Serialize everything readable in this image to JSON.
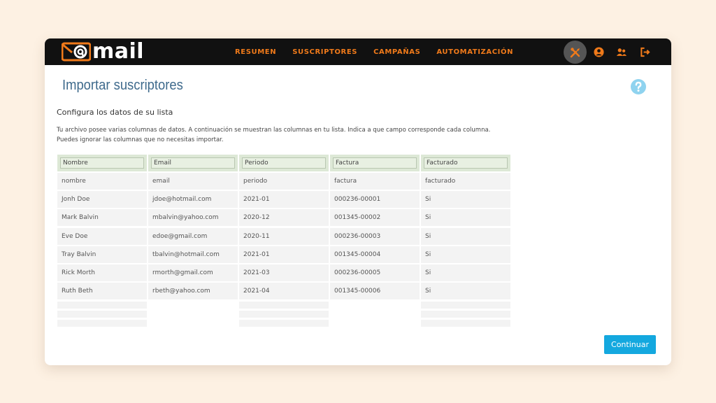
{
  "brand": {
    "logo_text": "mail",
    "accent": "#f07a1a"
  },
  "nav": [
    {
      "label": "RESUMEN"
    },
    {
      "label": "SUSCRIPTORES"
    },
    {
      "label": "CAMPAÑAS"
    },
    {
      "label": "AUTOMATIZACIÓN"
    }
  ],
  "header_icons": [
    "tools-icon",
    "user-circle-icon",
    "users-icon",
    "logout-icon"
  ],
  "page": {
    "title": "Importar suscriptores",
    "subtitle": "Configura los datos de su lista",
    "desc_line1": "Tu archivo posee varias columnas de datos. A continuación se muestran las columnas en tu lista. Indica a que campo corresponde cada columna.",
    "desc_line2": "Puedes ignorar las columnas que no necesitas importar."
  },
  "table": {
    "columns": [
      {
        "header": "Nombre",
        "values": [
          "nombre",
          "Jonh Doe",
          "Mark Balvin",
          "Eve Doe",
          "Tray Balvin",
          "Rick Morth",
          "Ruth Beth"
        ]
      },
      {
        "header": "Email",
        "values": [
          "email",
          "jdoe@hotmail.com",
          "mbalvin@yahoo.com",
          "edoe@gmail.com",
          "tbalvin@hotmail.com",
          "rmorth@gmail.com",
          "rbeth@yahoo.com"
        ]
      },
      {
        "header": "Periodo",
        "values": [
          "periodo",
          "2021-01",
          "2020-12",
          "2020-11",
          "2021-01",
          "2021-03",
          "2021-04"
        ]
      },
      {
        "header": "Factura",
        "values": [
          "factura",
          "000236-00001",
          "001345-00002",
          "000236-00003",
          "001345-00004",
          "000236-00005",
          "001345-00006"
        ]
      },
      {
        "header": "Facturado",
        "values": [
          "facturado",
          "Si",
          "Si",
          "Si",
          "Si",
          "Si",
          "Si"
        ]
      }
    ]
  },
  "actions": {
    "continue_label": "Continuar"
  },
  "colors": {
    "primary_button": "#14a8df",
    "header_bg": "#111111",
    "help_icon": "#8fd3ef"
  }
}
